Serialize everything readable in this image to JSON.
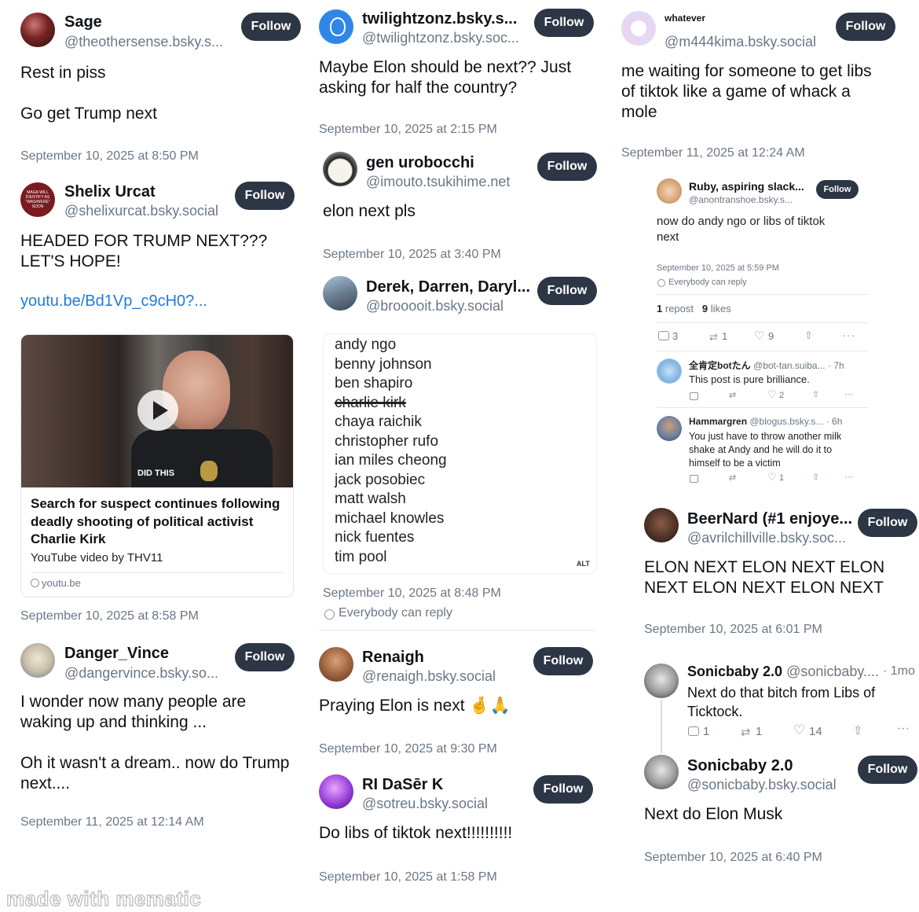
{
  "follow_label": "Follow",
  "col1": {
    "sage": {
      "name": "Sage",
      "handle": "@theothersense.bsky.s...",
      "text": "Rest in piss\n\nGo get Trump next",
      "date": "September 10, 2025 at 8:50 PM"
    },
    "shelix": {
      "name": "Shelix Urcat",
      "handle": "@shelixurcat.bsky.social",
      "avatar_text": "MAGA WILL IDENTIFY AS \"WAS/WERE\" SOON",
      "text": "HEADED FOR TRUMP NEXT???\nLET'S HOPE!",
      "link": "youtu.be/Bd1Vp_c9cH0?...",
      "card": {
        "overlay": "DID THIS",
        "title": "Search for suspect continues following deadly shooting of political activist Charlie Kirk",
        "source": "YouTube video by THV11",
        "domain": "youtu.be"
      },
      "date": "September 10, 2025 at 8:58 PM"
    },
    "danger": {
      "name": "Danger_Vince",
      "handle": "@dangervince.bsky.so...",
      "text": "I wonder now many people are\nwaking up and thinking ...\n\nOh it wasn't a dream.. now do Trump\nnext....",
      "date": "September 11, 2025 at 12:14 AM"
    }
  },
  "col2": {
    "twilight": {
      "name": "twilightzonz.bsky.s...",
      "handle": "@twilightzonz.bsky.soc...",
      "text": "Maybe Elon should be next?? Just\nasking for half the country?",
      "date": "September 10, 2025 at 2:15 PM"
    },
    "gen": {
      "name": "gen urobocchi",
      "handle": "@imouto.tsukihime.net",
      "text": "elon next pls",
      "date": "September 10, 2025 at 3:40 PM"
    },
    "derek": {
      "name": "Derek, Darren, Daryl...",
      "handle": "@brooooit.bsky.social",
      "list": [
        "andy ngo",
        "benny johnson",
        "ben shapiro",
        "charlie kirk",
        "chaya raichik",
        "christopher rufo",
        "ian miles cheong",
        "jack posobiec",
        "matt walsh",
        "michael knowles",
        "nick fuentes",
        "tim pool"
      ],
      "alt": "ALT",
      "date": "September 10, 2025 at 8:48 PM",
      "reply": "Everybody can reply"
    },
    "renaigh": {
      "name": "Renaigh",
      "handle": "@renaigh.bsky.social",
      "text": "Praying Elon is next 🤞🙏",
      "date": "September 10, 2025 at 9:30 PM"
    },
    "ri": {
      "name": "RI DaSēr K",
      "handle": "@sotreu.bsky.social",
      "text": "Do libs of tiktok next!!!!!!!!!!",
      "date": "September 10, 2025 at 1:58 PM"
    }
  },
  "col3": {
    "whatever": {
      "name": "whatever",
      "handle": "@m444kima.bsky.social",
      "text": "me waiting for someone to get libs\nof tiktok like a game of whack a\nmole",
      "date": "September 11, 2025 at 12:24 AM"
    },
    "ruby": {
      "name": "Ruby, aspiring slack...",
      "handle": "@anontranshoe.bsky.s...",
      "text": "now do andy ngo or libs of tiktok\nnext",
      "date": "September 10, 2025 at 5:59 PM",
      "reply": "Everybody can reply",
      "repost_count": "1",
      "repost_label": "repost",
      "like_count": "9",
      "like_label": "likes",
      "counts": {
        "reply": "3",
        "repost": "1",
        "like": "9"
      }
    },
    "bot": {
      "name": "全肯定botたん",
      "handle": "@bot-tan.suiba...",
      "time": "· 7h",
      "text": "This post is pure brilliance.",
      "like": "2"
    },
    "hamm": {
      "name": "Hammargren",
      "handle": "@blogus.bsky.s...",
      "time": "· 6h",
      "text": "You just have to throw another milk\nshake at Andy and he will do it to\nhimself to be a victim",
      "like": "1"
    },
    "beer": {
      "name": "BeerNard (#1 enjoye...",
      "handle": "@avrilchillville.bsky.soc...",
      "text": "ELON NEXT ELON NEXT ELON\nNEXT ELON NEXT ELON NEXT",
      "date": "September 10, 2025 at 6:01 PM"
    },
    "sonic1": {
      "name": "Sonicbaby 2.0",
      "handle": "@sonicbaby....",
      "time": "· 1mo",
      "text": "Next do that bitch from Libs of\nTicktock.",
      "reply": "1",
      "repost": "1",
      "like": "14"
    },
    "sonic2": {
      "name": "Sonicbaby 2.0",
      "handle": "@sonicbaby.bsky.social",
      "text": "Next do Elon Musk",
      "date": "September 10, 2025 at 6:40 PM"
    }
  },
  "watermark": "made with mematic"
}
